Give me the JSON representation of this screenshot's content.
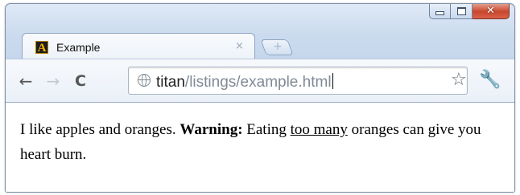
{
  "window": {
    "controls": {
      "minimize_icon": "minimize-icon",
      "maximize_icon": "maximize-icon",
      "close_icon": "close-icon",
      "close_color": "#c8472e"
    }
  },
  "tab": {
    "favicon_letter": "A",
    "title": "Example",
    "close_glyph": "×",
    "new_tab_glyph": "+"
  },
  "toolbar": {
    "back_glyph": "←",
    "forward_glyph": "→",
    "reload_glyph": "C",
    "address": {
      "host": "titan",
      "path": "/listings/example.html"
    },
    "star_glyph": "☆",
    "wrench_glyph": "🔧"
  },
  "page": {
    "text_1": "I like apples and oranges. ",
    "warning_label": "Warning:",
    "text_2": " Eating ",
    "underlined": "too many",
    "text_3": " oranges can give you heart burn."
  },
  "colors": {
    "window_frame": "#c1d3ea",
    "close_button": "#c8472e",
    "url_path": "#7f8a96"
  }
}
